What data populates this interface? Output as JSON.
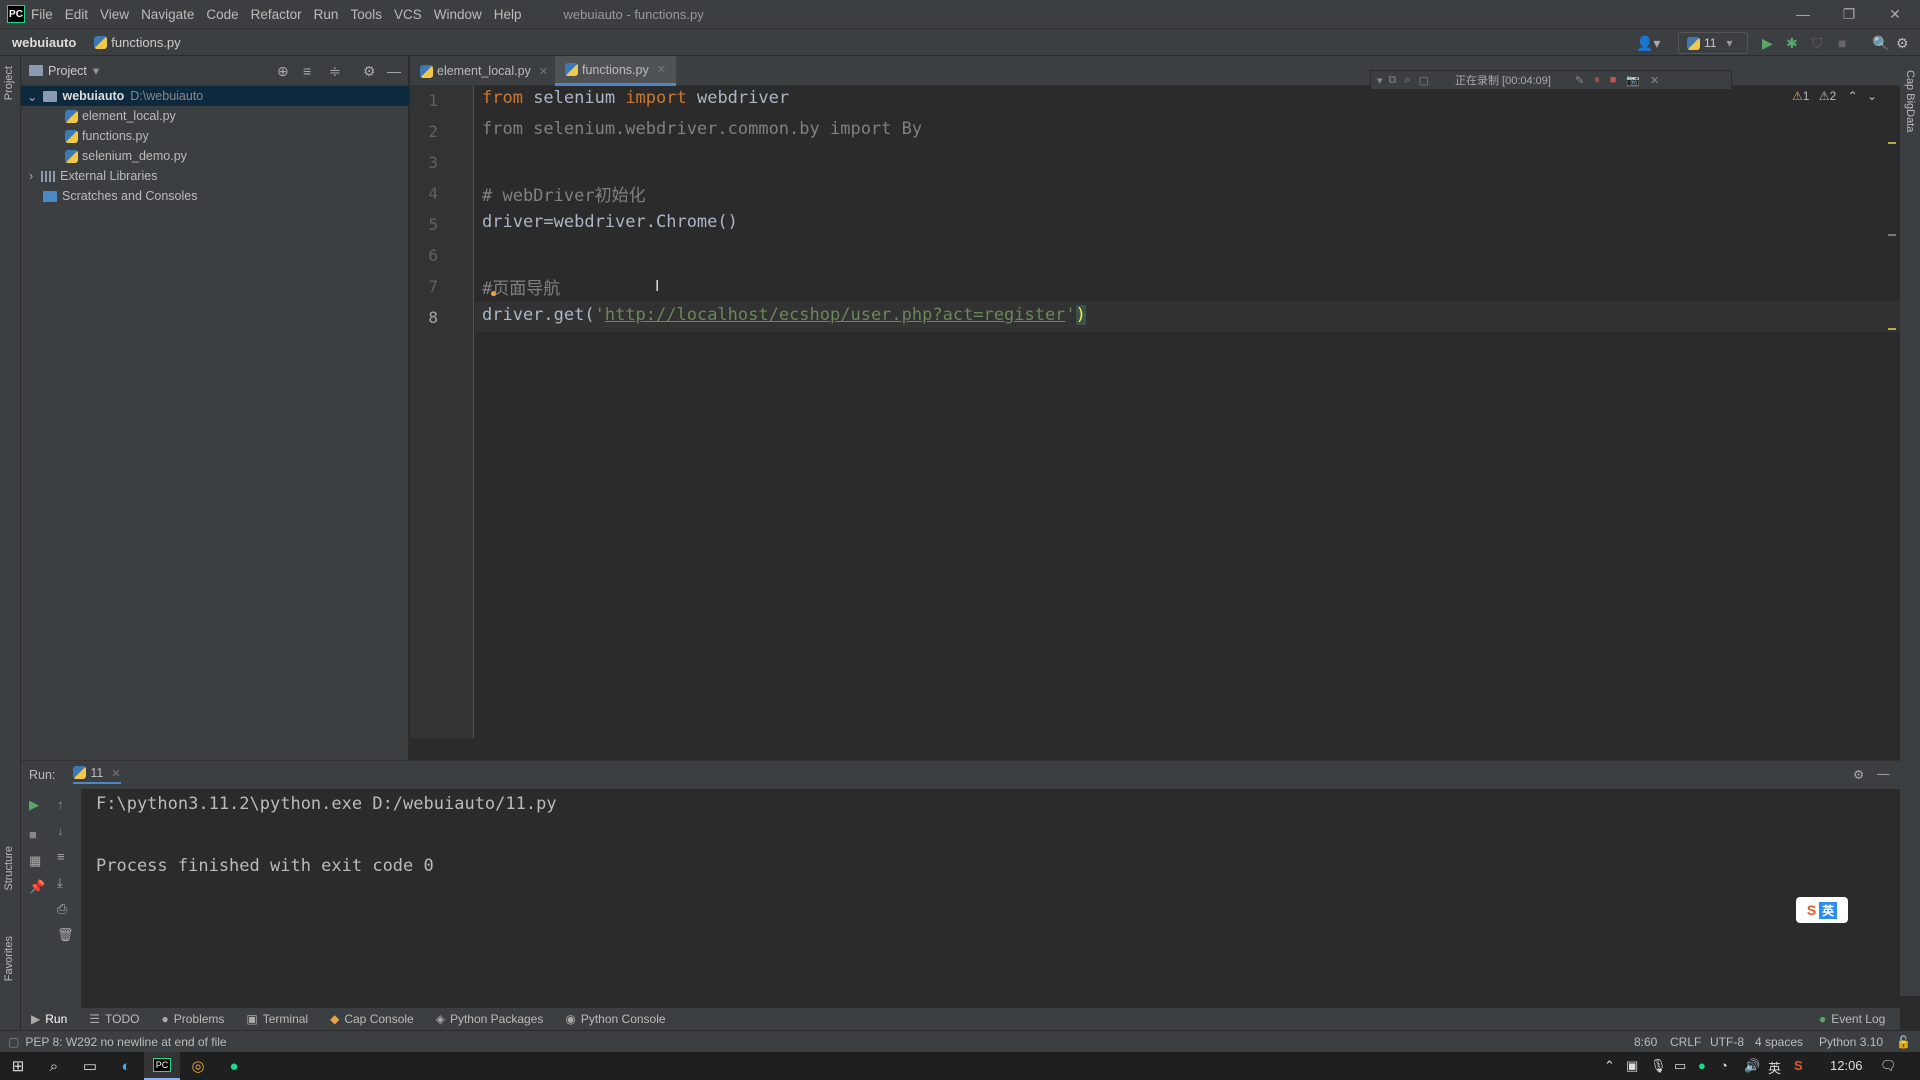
{
  "window": {
    "logo": "PC",
    "title": "webuiauto - functions.py"
  },
  "menu": [
    "File",
    "Edit",
    "View",
    "Navigate",
    "Code",
    "Refactor",
    "Run",
    "Tools",
    "VCS",
    "Window",
    "Help"
  ],
  "breadcrumb": {
    "project": "webuiauto",
    "file": "functions.py"
  },
  "run_config": "11",
  "project_panel": {
    "title": "Project",
    "root": {
      "name": "webuiauto",
      "path": "D:\\webuiauto"
    },
    "files": [
      "element_local.py",
      "functions.py",
      "selenium_demo.py"
    ],
    "external": "External Libraries",
    "scratches": "Scratches and Consoles"
  },
  "left_strip": {
    "project": "Project",
    "structure": "Structure",
    "favorites": "Favorites"
  },
  "right_strip": {
    "label": "Cap BigData"
  },
  "tabs": [
    {
      "label": "element_local.py",
      "active": false
    },
    {
      "label": "functions.py",
      "active": true
    }
  ],
  "recording": {
    "label": "正在录制 [00:04:09]"
  },
  "inspections": {
    "warnings": "1",
    "weak": "2"
  },
  "code": {
    "line_numbers": [
      "1",
      "2",
      "3",
      "4",
      "5",
      "6",
      "7",
      "8"
    ],
    "l1": {
      "kw1": "from",
      "mod": " selenium ",
      "kw2": "import",
      "name": " webdriver"
    },
    "l2": "from selenium.webdriver.common.by import By",
    "l4": "# webDriver初始化",
    "l5": "driver=webdriver.Chrome()",
    "l7": "#页面导航",
    "l8": {
      "prefix": "driver.get(",
      "q1": "'",
      "url": "http://localhost/ecshop/user.php?act=register",
      "q2": "'",
      "suffix": ")"
    }
  },
  "run_panel": {
    "label": "Run:",
    "tab": "11",
    "output": [
      "F:\\python3.11.2\\python.exe D:/webuiauto/11.py",
      "Process finished with exit code 0"
    ]
  },
  "tool_windows": [
    "Run",
    "TODO",
    "Problems",
    "Terminal",
    "Cap Console",
    "Python Packages",
    "Python Console"
  ],
  "event_log": "Event Log",
  "status": {
    "message": "PEP 8: W292 no newline at end of file",
    "position": "8:60",
    "line_sep": "CRLF",
    "encoding": "UTF-8",
    "indent": "4 spaces",
    "interpreter": "Python 3.10"
  },
  "ime": {
    "s": "S",
    "lang": "英"
  },
  "taskbar": {
    "time": "12:06",
    "lang": "英"
  }
}
